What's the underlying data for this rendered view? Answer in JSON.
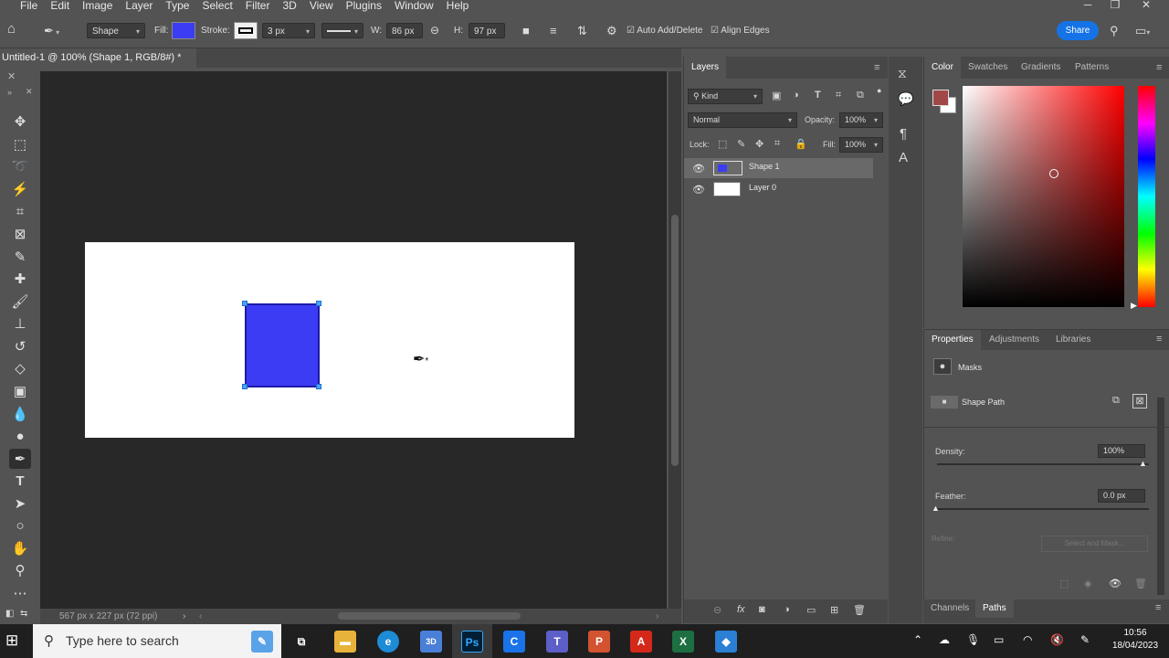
{
  "menubar": {
    "items": [
      "File",
      "Edit",
      "Image",
      "Layer",
      "Type",
      "Select",
      "Filter",
      "3D",
      "View",
      "Plugins",
      "Window",
      "Help"
    ]
  },
  "options": {
    "mode": "Shape",
    "fill_label": "Fill:",
    "stroke_label": "Stroke:",
    "stroke_width": "3 px",
    "w_label": "W:",
    "w_value": "86 px",
    "h_label": "H:",
    "h_value": "97 px",
    "auto_add_delete": "Auto Add/Delete",
    "align_edges": "Align Edges",
    "share": "Share",
    "fill_color": "#3c3cf5"
  },
  "document": {
    "tab_title": "Untitled-1 @ 100% (Shape 1, RGB/8#) *",
    "status": "567 px x 227 px (72 ppi)"
  },
  "layers_panel": {
    "title": "Layers",
    "kind": "Kind",
    "blend_mode": "Normal",
    "opacity_label": "Opacity:",
    "opacity": "100%",
    "lock_label": "Lock:",
    "fill_label": "Fill:",
    "fill": "100%",
    "layers": [
      {
        "name": "Shape 1"
      },
      {
        "name": "Layer 0"
      }
    ]
  },
  "color_panel": {
    "tabs": [
      "Color",
      "Swatches",
      "Gradients",
      "Patterns"
    ],
    "foreground": "#a04848"
  },
  "properties_panel": {
    "tabs": [
      "Properties",
      "Adjustments",
      "Libraries"
    ],
    "masks": "Masks",
    "shape_path": "Shape Path",
    "density_label": "Density:",
    "density": "100%",
    "feather_label": "Feather:",
    "feather": "0.0 px",
    "refine_label": "Refine:",
    "select_and_mask": "Select and Mask..."
  },
  "bottom_tabs": [
    "Channels",
    "Paths"
  ],
  "taskbar": {
    "search_placeholder": "Type here to search",
    "time": "10:56",
    "date": "18/04/2023"
  }
}
